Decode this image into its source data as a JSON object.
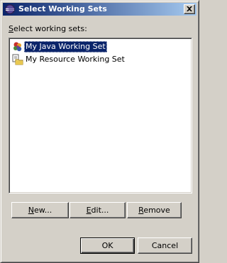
{
  "window": {
    "title": "Select Working Sets",
    "icon": "eclipse-icon"
  },
  "list": {
    "label_mnemonic": "S",
    "label_rest": "elect working sets:",
    "items": [
      {
        "label": "My Java Working Set",
        "icon": "java-working-set-icon",
        "selected": true
      },
      {
        "label": "My Resource Working Set",
        "icon": "resource-working-set-icon",
        "selected": false
      }
    ]
  },
  "buttons": {
    "new_mnemonic": "N",
    "new_rest": "ew...",
    "edit_mnemonic": "E",
    "edit_rest": "dit...",
    "remove_mnemonic": "R",
    "remove_rest": "emove",
    "ok": "OK",
    "cancel": "Cancel"
  },
  "colors": {
    "selection": "#0a246a",
    "face": "#d4d0c8"
  }
}
